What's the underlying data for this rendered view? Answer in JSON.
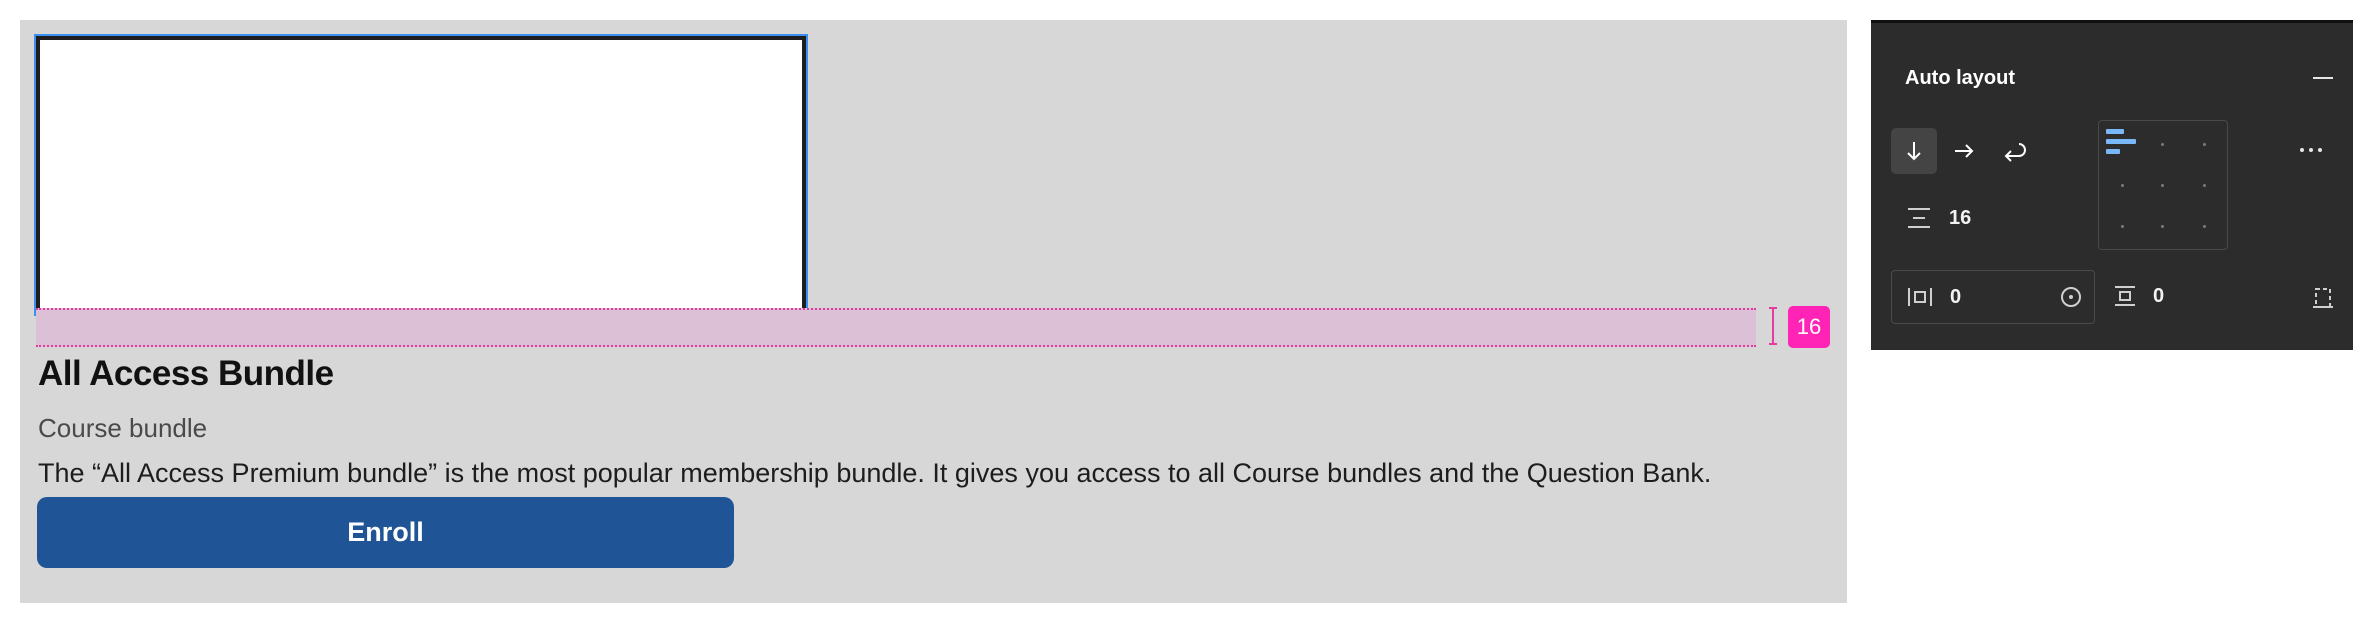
{
  "canvas": {
    "gap_badge": "16",
    "title": "All Access Bundle",
    "subtitle": "Course bundle",
    "description": "The “All Access Premium bundle” is the most popular membership bundle. It gives you access to all Course bundles and the Question Bank.",
    "button_label": "Enroll"
  },
  "panel": {
    "title": "Auto layout",
    "direction_buttons": [
      "arrow-down-icon",
      "arrow-right-icon",
      "wrap-icon"
    ],
    "gap_value": "16",
    "padding_horizontal_value": "0",
    "padding_vertical_value": "0"
  },
  "colors": {
    "canvas_bg": "#d7d7d7",
    "button_bg": "#1f5596",
    "gap_highlight": "#ff24b5",
    "panel_bg": "#2c2c2c",
    "selection_blue": "#3c8ff0"
  }
}
